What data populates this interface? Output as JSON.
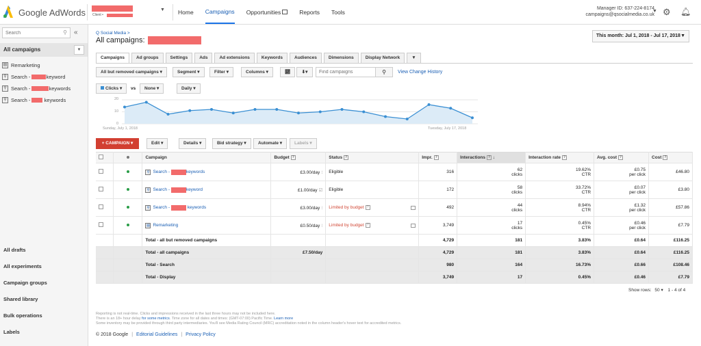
{
  "app": {
    "name": "Google AdWords"
  },
  "client": {
    "label": "Client •"
  },
  "topnav": {
    "home": "Home",
    "campaigns": "Campaigns",
    "opportunities": "Opportunities",
    "reports": "Reports",
    "tools": "Tools"
  },
  "account": {
    "manager_id": "Manager ID: 637-224-8174",
    "email": "campaigns@qsocialmedia.co.uk"
  },
  "sidebar": {
    "search_placeholder": "Search",
    "all_campaigns": "All campaigns",
    "items": [
      {
        "label_pre": "Remarketing",
        "label_post": "",
        "icon": "display-icon"
      },
      {
        "label_pre": "Search - ",
        "label_post": "keyword",
        "icon": "search-icon"
      },
      {
        "label_pre": "Search - ",
        "label_post": "keywords",
        "icon": "search-icon"
      },
      {
        "label_pre": "Search - ",
        "label_post": " keywords",
        "icon": "search-icon"
      }
    ],
    "bottom": [
      "All drafts",
      "All experiments",
      "Campaign groups",
      "Shared library",
      "Bulk operations",
      "Labels"
    ]
  },
  "main": {
    "breadcrumb": "Q Social Media >",
    "title": "All campaigns:",
    "date_range": "This month: Jul 1, 2018 - Jul 17, 2018",
    "tabs": [
      "Campaigns",
      "Ad groups",
      "Settings",
      "Ads",
      "Ad extensions",
      "Keywords",
      "Audiences",
      "Dimensions",
      "Display Network"
    ],
    "toolbar": {
      "filter_view": "All but removed campaigns ▾",
      "segment": "Segment ▾",
      "filter": "Filter ▾",
      "columns": "Columns ▾",
      "find_placeholder": "Find campaigns",
      "view_history": "View Change History"
    },
    "metric_bar": {
      "metric1": "Clicks ▾",
      "vs": "vs",
      "metric2": "None ▾",
      "period": "Daily ▾"
    },
    "actions": {
      "campaign": "+ CAMPAIGN ▾",
      "edit": "Edit ▾",
      "details": "Details ▾",
      "bid_strategy": "Bid strategy ▾",
      "automate": "Automate ▾",
      "labels": "Labels ▾"
    }
  },
  "chart_data": {
    "type": "area",
    "x": [
      "Jul 1",
      "Jul 2",
      "Jul 3",
      "Jul 4",
      "Jul 5",
      "Jul 6",
      "Jul 7",
      "Jul 8",
      "Jul 9",
      "Jul 10",
      "Jul 11",
      "Jul 12",
      "Jul 13",
      "Jul 14",
      "Jul 15",
      "Jul 16",
      "Jul 17"
    ],
    "series": [
      {
        "name": "Clicks",
        "values": [
          14,
          18,
          8,
          11,
          12,
          9,
          12,
          12,
          9,
          10,
          12,
          10,
          6,
          4,
          16,
          13,
          5
        ]
      }
    ],
    "yticks": [
      "20",
      "10",
      "0"
    ],
    "ylim": [
      0,
      20
    ],
    "x_start_label": "Sunday, July 1, 2018",
    "x_end_label": "Tuesday, July 17, 2018",
    "color": "#3a8fd3",
    "fill": "#dcebf7"
  },
  "table": {
    "headers": {
      "campaign": "Campaign",
      "budget": "Budget",
      "status": "Status",
      "impr": "Impr.",
      "interactions": "Interactions",
      "interaction_rate": "Interaction rate",
      "avg_cost": "Avg. cost",
      "cost": "Cost"
    },
    "rows": [
      {
        "name_pre": "Search - ",
        "name_post": "keywords",
        "icon": "search-icon",
        "budget": "£3.00/day",
        "status": "Eligible",
        "limited": false,
        "impr": "316",
        "interactions": "62",
        "inter_unit": "clicks",
        "rate": "19.62%",
        "rate_unit": "CTR",
        "avg_cost": "£0.75",
        "avg_unit": "per click",
        "cost": "£46.80"
      },
      {
        "name_pre": "Search - ",
        "name_post": "keyword",
        "icon": "search-icon",
        "budget": "£1.00/day",
        "status": "Eligible",
        "limited": false,
        "impr": "172",
        "interactions": "58",
        "inter_unit": "clicks",
        "rate": "33.72%",
        "rate_unit": "CTR",
        "avg_cost": "£0.07",
        "avg_unit": "per click",
        "cost": "£3.80"
      },
      {
        "name_pre": "Search - ",
        "name_post": " keywords",
        "icon": "search-icon",
        "budget": "£3.00/day",
        "status": "Limited by budget",
        "limited": true,
        "impr": "492",
        "interactions": "44",
        "inter_unit": "clicks",
        "rate": "8.94%",
        "rate_unit": "CTR",
        "avg_cost": "£1.32",
        "avg_unit": "per click",
        "cost": "£57.86"
      },
      {
        "name_pre": "Remarketing",
        "name_post": "",
        "icon": "display-icon",
        "budget": "£0.50/day",
        "status": "Limited by budget",
        "limited": true,
        "impr": "3,749",
        "interactions": "17",
        "inter_unit": "clicks",
        "rate": "0.45%",
        "rate_unit": "CTR",
        "avg_cost": "£0.46",
        "avg_unit": "per click",
        "cost": "£7.79"
      }
    ],
    "totals": [
      {
        "label": "Total - all but removed campaigns",
        "budget": "",
        "impr": "4,729",
        "interactions": "181",
        "rate": "3.83%",
        "avg_cost": "£0.64",
        "cost": "£116.25",
        "shade": false
      },
      {
        "label": "Total - all campaigns",
        "budget": "£7.50/day",
        "impr": "4,729",
        "interactions": "181",
        "rate": "3.83%",
        "avg_cost": "£0.64",
        "cost": "£116.25",
        "shade": true
      },
      {
        "label": "Total - Search",
        "budget": "",
        "impr": "980",
        "interactions": "164",
        "rate": "16.73%",
        "avg_cost": "£0.66",
        "cost": "£108.46",
        "shade": true
      },
      {
        "label": "Total - Display",
        "budget": "",
        "impr": "3,749",
        "interactions": "17",
        "rate": "0.45%",
        "avg_cost": "£0.46",
        "cost": "£7.79",
        "shade": true
      }
    ],
    "show_rows_label": "Show rows:",
    "show_rows_value": "50",
    "range": "1 - 4 of 4"
  },
  "footnotes": {
    "line1": "Reporting is not real-time. Clicks and impressions received in the last three hours may not be included here.",
    "line2_pre": "There is an 18+ hour delay ",
    "line2_link": "for some metrics",
    "line2_post": ". Time zone for all dates and times: (GMT-07:00) Pacific Time. ",
    "line2_link2": "Learn more",
    "line3": "Some inventory may be provided through third party intermediaries. You'll see Media Rating Council (MRC) accreditation noted in the column header's hover text for accredited metrics."
  },
  "footer": {
    "copyright": "© 2018 Google",
    "editorial": "Editorial Guidelines",
    "privacy": "Privacy Policy"
  }
}
